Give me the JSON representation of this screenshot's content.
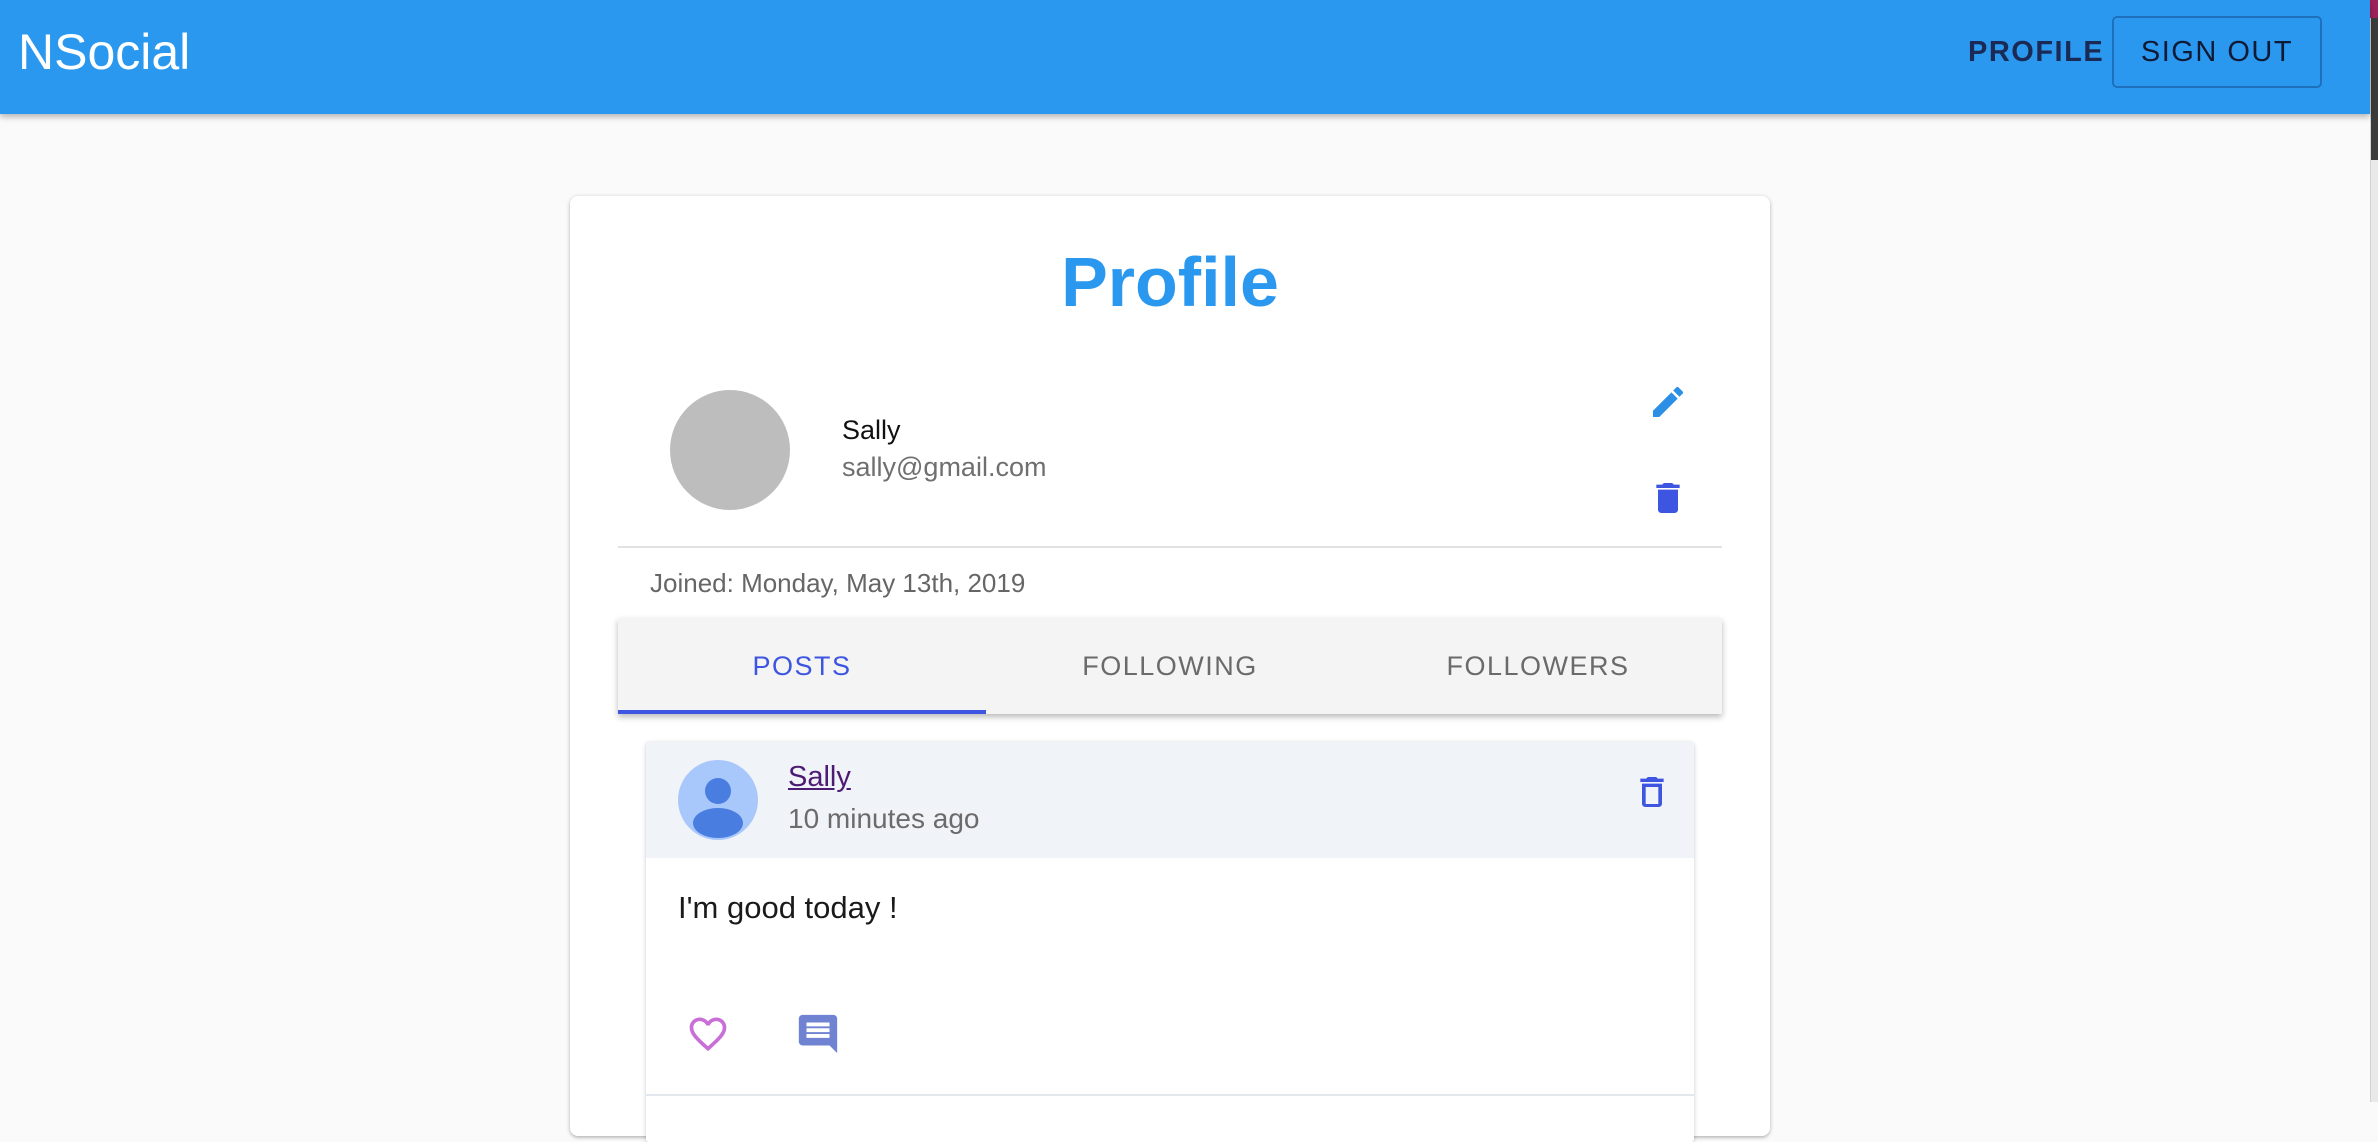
{
  "appbar": {
    "brand": "NSocial",
    "profile_link": "PROFILE",
    "signout_button": "SIGN OUT",
    "color": "#2b98f0"
  },
  "profile": {
    "title": "Profile",
    "name": "Sally",
    "email": "sally@gmail.com",
    "joined": "Joined: Monday, May 13th, 2019",
    "icons": {
      "edit": "pencil-icon",
      "delete": "trash-icon"
    }
  },
  "tabs": {
    "items": [
      {
        "label": "POSTS",
        "active": true
      },
      {
        "label": "FOLLOWING",
        "active": false
      },
      {
        "label": "FOLLOWERS",
        "active": false
      }
    ],
    "active_color": "#3d55e0"
  },
  "posts": [
    {
      "author": "Sally",
      "time": "10 minutes ago",
      "text": "I'm good today !",
      "icons": {
        "avatar": "person-icon",
        "delete": "trash-icon",
        "like": "heart-outline-icon",
        "comment": "comment-icon"
      }
    }
  ]
}
